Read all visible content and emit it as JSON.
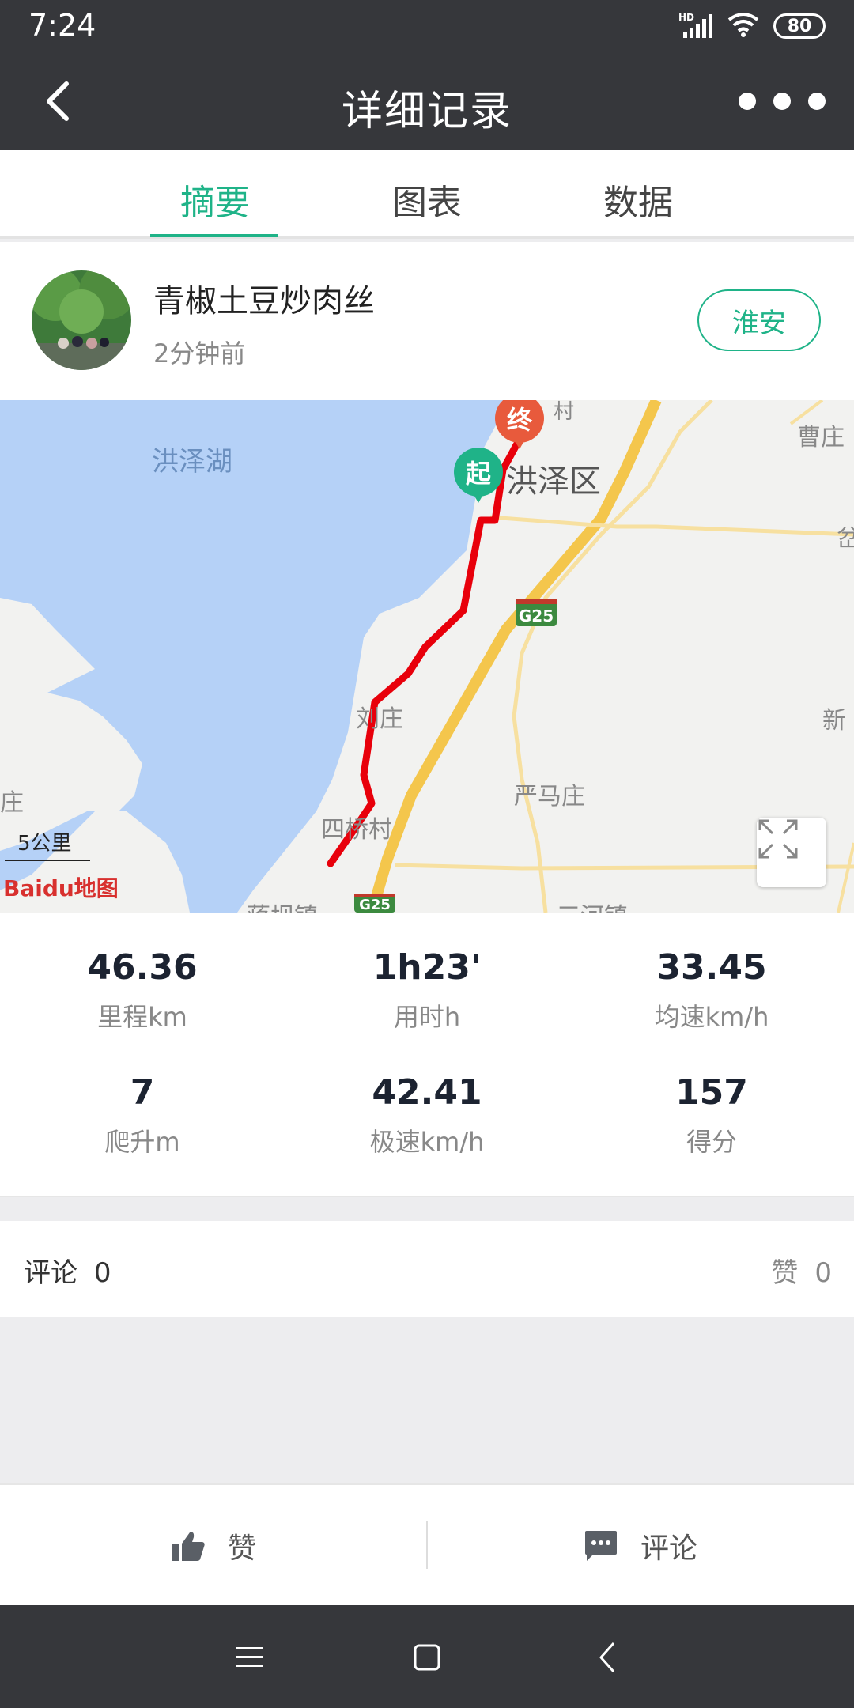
{
  "status": {
    "time": "7:24",
    "battery": "80",
    "network": "HD"
  },
  "header": {
    "title": "详细记录"
  },
  "tabs": [
    {
      "label": "摘要",
      "active": true
    },
    {
      "label": "图表",
      "active": false
    },
    {
      "label": "数据",
      "active": false
    }
  ],
  "profile": {
    "name": "青椒土豆炒肉丝",
    "time": "2分钟前",
    "city": "淮安"
  },
  "map": {
    "labels": {
      "lake": "洪泽湖",
      "district": "洪泽区",
      "caozhuang": "曹庄",
      "dengzhuang": "刘庄",
      "yanmazhuang": "严马庄",
      "sihecun": "四桥村",
      "zhuang_left": "庄",
      "xin_right": "新",
      "gu_right": "岔",
      "jiangbazhen": "蒋坝镇",
      "sanhezhen": "三河镇",
      "cun_top": "村",
      "highway_1": "G25",
      "highway_2": "G25"
    },
    "start_marker": "起",
    "end_marker": "终",
    "scale": "5公里",
    "logo": "Baidu地图"
  },
  "stats": [
    {
      "value": "46.36",
      "label": "里程km"
    },
    {
      "value": "1h23'",
      "label": "用时h"
    },
    {
      "value": "33.45",
      "label": "均速km/h"
    },
    {
      "value": "7",
      "label": "爬升m"
    },
    {
      "value": "42.41",
      "label": "极速km/h"
    },
    {
      "value": "157",
      "label": "得分"
    }
  ],
  "comments": {
    "comment_label": "评论",
    "comment_count": "0",
    "like_label": "赞",
    "like_count": "0"
  },
  "actions": {
    "like": "赞",
    "comment": "评论"
  },
  "colors": {
    "accent": "#1fb388",
    "header": "#36373b",
    "route": "#e8000b"
  }
}
